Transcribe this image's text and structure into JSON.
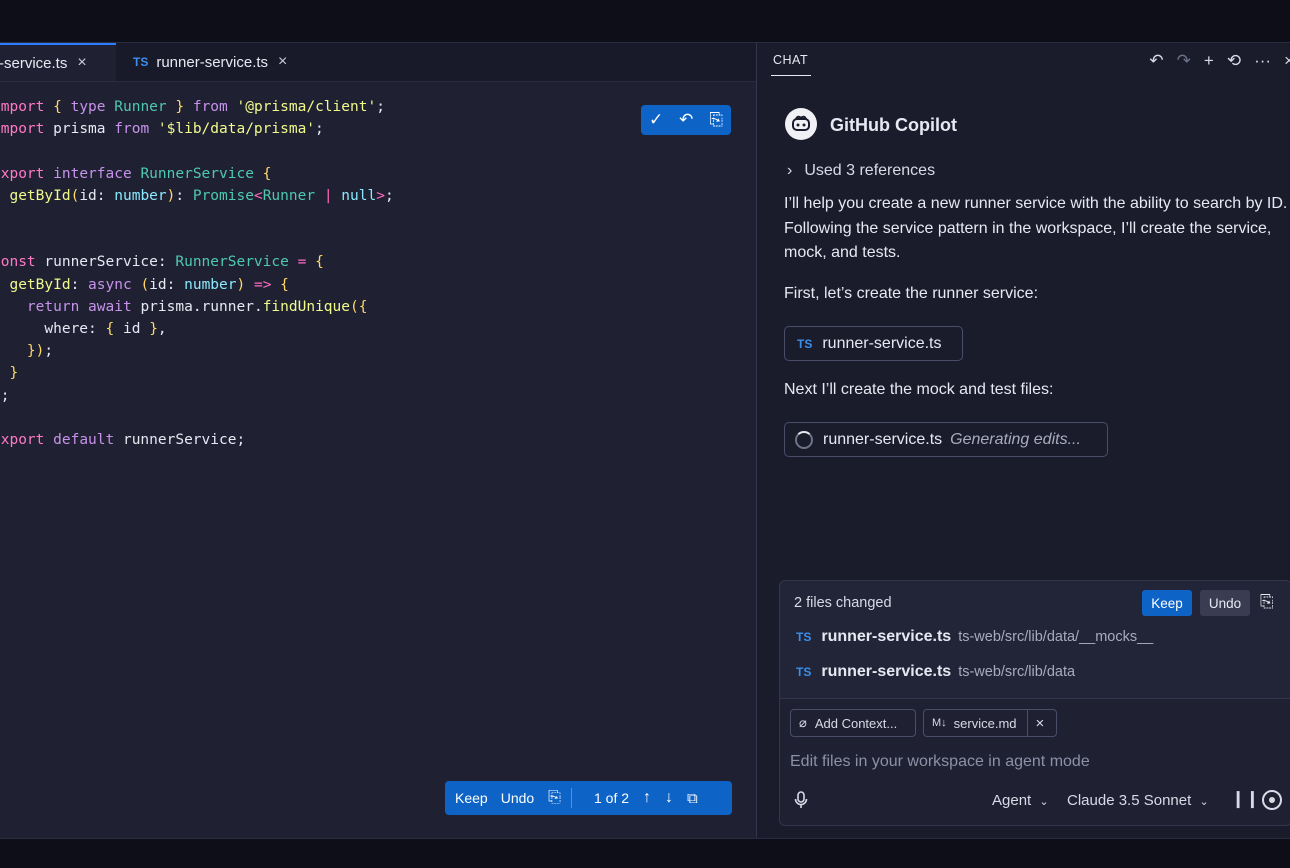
{
  "editor": {
    "tabs": [
      {
        "label": "r-service.ts",
        "close": "×"
      },
      {
        "badge": "TS",
        "label": "runner-service.ts",
        "close": "×"
      }
    ],
    "code_lines": [
      "import { type Runner } from '@prisma/client';",
      "import prisma from '$lib/data/prisma';",
      "",
      "export interface RunnerService {",
      "  getById(id: number): Promise<Runner | null>;",
      "}",
      "",
      "const runnerService: RunnerService = {",
      "  getById: async (id: number) => {",
      "    return await prisma.runner.findUnique({",
      "      where: { id },",
      "    });",
      "  }",
      "};",
      "",
      "export default runnerService;"
    ],
    "inline_actions": {
      "accept_icon": "✓",
      "undo_icon": "↶",
      "diff_icon": "⎘"
    },
    "diff_bar": {
      "keep": "Keep",
      "undo": "Undo",
      "position": "1 of 2",
      "up": "↑",
      "down": "↓"
    }
  },
  "chat": {
    "header": "CHAT",
    "tools": [
      "↶",
      "↷",
      "+",
      "⟲",
      "···",
      "×"
    ],
    "assistant_name": "GitHub Copilot",
    "references": "Used 3 references",
    "message_1": "I’ll help you create a new runner service with the ability to search by ID. Following the service pattern in the workspace, I’ll create the service, mock, and tests.",
    "message_2": "First, let’s create the runner service:",
    "file_chip": {
      "badge": "TS",
      "name": "runner-service.ts"
    },
    "message_3": "Next I’ll create the mock and test files:",
    "generating_chip": {
      "name": "runner-service.ts",
      "status": "Generating edits..."
    },
    "changes": {
      "title": "2 files changed",
      "keep": "Keep",
      "undo": "Undo",
      "files": [
        {
          "badge": "TS",
          "name": "runner-service.ts",
          "path": "ts-web/src/lib/data/__mocks__"
        },
        {
          "badge": "TS",
          "name": "runner-service.ts",
          "path": "ts-web/src/lib/data"
        }
      ]
    },
    "input": {
      "add_context": "Add Context...",
      "context_file": "service.md",
      "placeholder": "Edit files in your workspace in agent mode",
      "mode": "Agent",
      "model": "Claude 3.5 Sonnet"
    }
  }
}
